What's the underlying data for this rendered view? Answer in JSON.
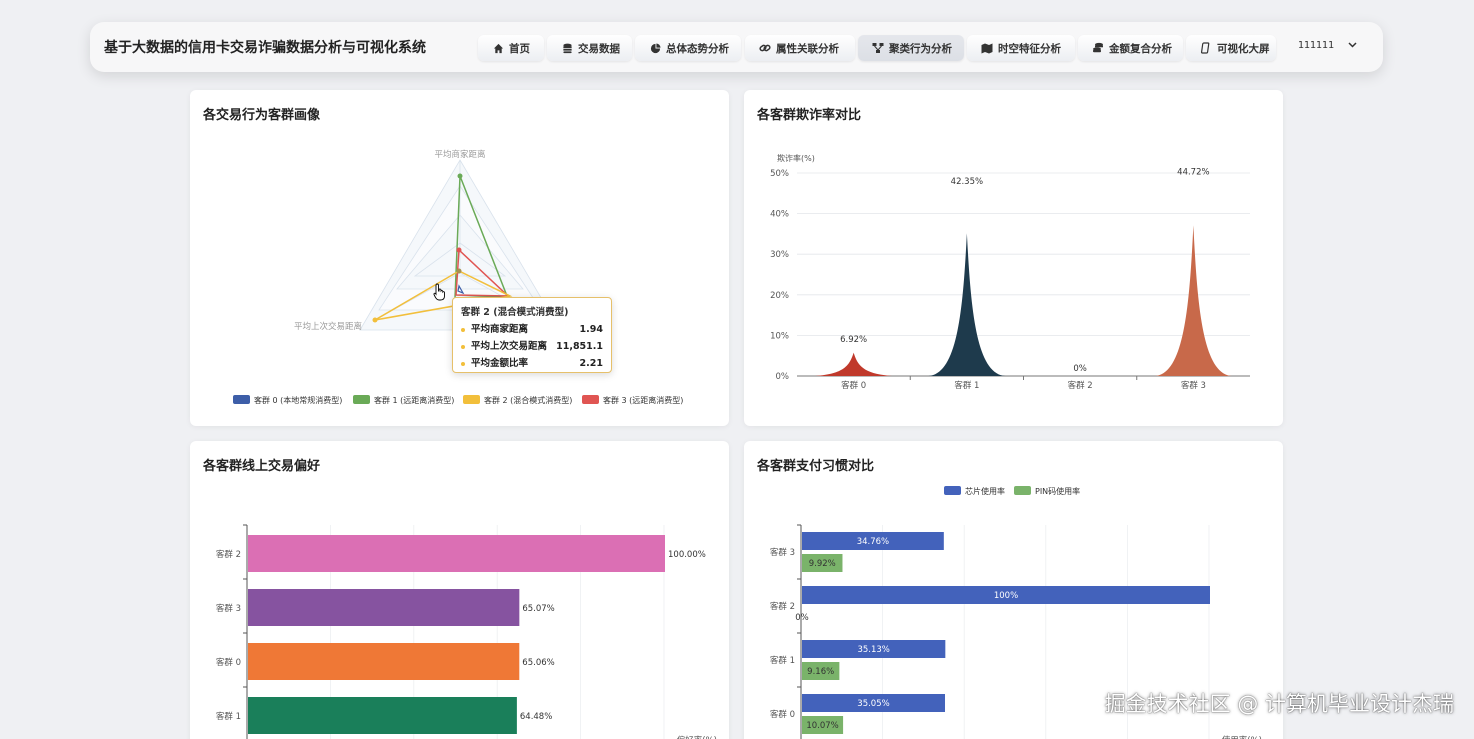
{
  "header": {
    "app_title": "基于大数据的信用卡交易诈骗数据分析与可视化系统",
    "tabs": [
      {
        "label": "首页",
        "icon": "home-icon"
      },
      {
        "label": "交易数据",
        "icon": "database-icon"
      },
      {
        "label": "总体态势分析",
        "icon": "pie-icon"
      },
      {
        "label": "属性关联分析",
        "icon": "link-icon"
      },
      {
        "label": "聚类行为分析",
        "icon": "cluster-icon",
        "active": true
      },
      {
        "label": "时空特征分析",
        "icon": "map-icon"
      },
      {
        "label": "金额复合分析",
        "icon": "coins-icon"
      },
      {
        "label": "可视化大屏",
        "icon": "screen-icon"
      }
    ],
    "user": "111111"
  },
  "panels": {
    "radar": {
      "title": "各交易行为客群画像",
      "indicators": [
        "平均商家距离",
        "平均上次交易距离",
        "平均金额比率"
      ],
      "legend": [
        "客群 0 (本地常规消费型)",
        "客群 1 (远距离消费型)",
        "客群 2 (混合模式消费型)",
        "客群 3 (远距离消费型)"
      ],
      "colors": [
        "#3d5ea8",
        "#6aaa57",
        "#f2bf3b",
        "#e05552"
      ],
      "tooltip": {
        "title": "客群 2 (混合模式消费型)",
        "rows": [
          {
            "k": "平均商家距离",
            "v": "1.94"
          },
          {
            "k": "平均上次交易距离",
            "v": "11,851.1"
          },
          {
            "k": "平均金额比率",
            "v": "2.21"
          }
        ]
      }
    },
    "fraud": {
      "title": "各客群欺诈率对比",
      "ylabel": "欺诈率(%)",
      "yticks": [
        "50%",
        "40%",
        "30%",
        "20%",
        "10%",
        "0%"
      ],
      "categories": [
        "客群 0",
        "客群 1",
        "客群 2",
        "客群 3"
      ],
      "value_labels": [
        "6.92%",
        "42.35%",
        "0%",
        "44.72%"
      ],
      "colors": [
        "#c0392b",
        "#1e3a4c",
        "#888888",
        "#c8694a"
      ]
    },
    "online": {
      "title": "各客群线上交易偏好",
      "categories": [
        "客群 2",
        "客群 3",
        "客群 0",
        "客群 1"
      ],
      "value_labels": [
        "100.00%",
        "65.07%",
        "65.06%",
        "64.48%"
      ],
      "colors": [
        "#db6fb4",
        "#8653a0",
        "#ef7836",
        "#1a7f5a"
      ],
      "xlabel": "偏好率(%)"
    },
    "payment": {
      "title": "各客群支付习惯对比",
      "legend": [
        "芯片使用率",
        "PIN码使用率"
      ],
      "colors": [
        "#4362bb",
        "#7ab36a"
      ],
      "categories": [
        "客群 3",
        "客群 2",
        "客群 1",
        "客群 0"
      ],
      "chip_labels": [
        "34.76%",
        "100%",
        "35.13%",
        "35.05%"
      ],
      "pin_labels": [
        "9.92%",
        "0%",
        "9.16%",
        "10.07%"
      ],
      "xlabel": "使用率(%)"
    }
  },
  "chart_data": [
    {
      "type": "radar",
      "title": "各交易行为客群画像",
      "indicators": [
        "平均商家距离",
        "平均上次交易距离",
        "平均金额比率"
      ],
      "series": [
        {
          "name": "客群 0 (本地常规消费型)"
        },
        {
          "name": "客群 1 (远距离消费型)"
        },
        {
          "name": "客群 2 (混合模式消费型)",
          "values": [
            1.94,
            11851.1,
            2.21
          ]
        },
        {
          "name": "客群 3 (远距离消费型)"
        }
      ],
      "legend": "bottom"
    },
    {
      "type": "area",
      "title": "各客群欺诈率对比",
      "categories": [
        "客群 0",
        "客群 1",
        "客群 2",
        "客群 3"
      ],
      "values": [
        6.92,
        42.35,
        0,
        44.72
      ],
      "ylabel": "欺诈率(%)",
      "ylim": [
        0,
        50
      ]
    },
    {
      "type": "bar",
      "title": "各客群线上交易偏好",
      "categories": [
        "客群 2",
        "客群 3",
        "客群 0",
        "客群 1"
      ],
      "values": [
        100.0,
        65.07,
        65.06,
        64.48
      ],
      "xlabel": "偏好率(%)",
      "xlim": [
        0,
        100
      ]
    },
    {
      "type": "bar",
      "title": "各客群支付习惯对比",
      "categories": [
        "客群 3",
        "客群 2",
        "客群 1",
        "客群 0"
      ],
      "series": [
        {
          "name": "芯片使用率",
          "values": [
            34.76,
            100,
            35.13,
            35.05
          ]
        },
        {
          "name": "PIN码使用率",
          "values": [
            9.92,
            0,
            9.16,
            10.07
          ]
        }
      ],
      "xlabel": "使用率(%)",
      "xlim": [
        0,
        100
      ],
      "legend": "top"
    }
  ],
  "watermark": "掘金技术社区 @ 计算机毕业设计杰瑞"
}
